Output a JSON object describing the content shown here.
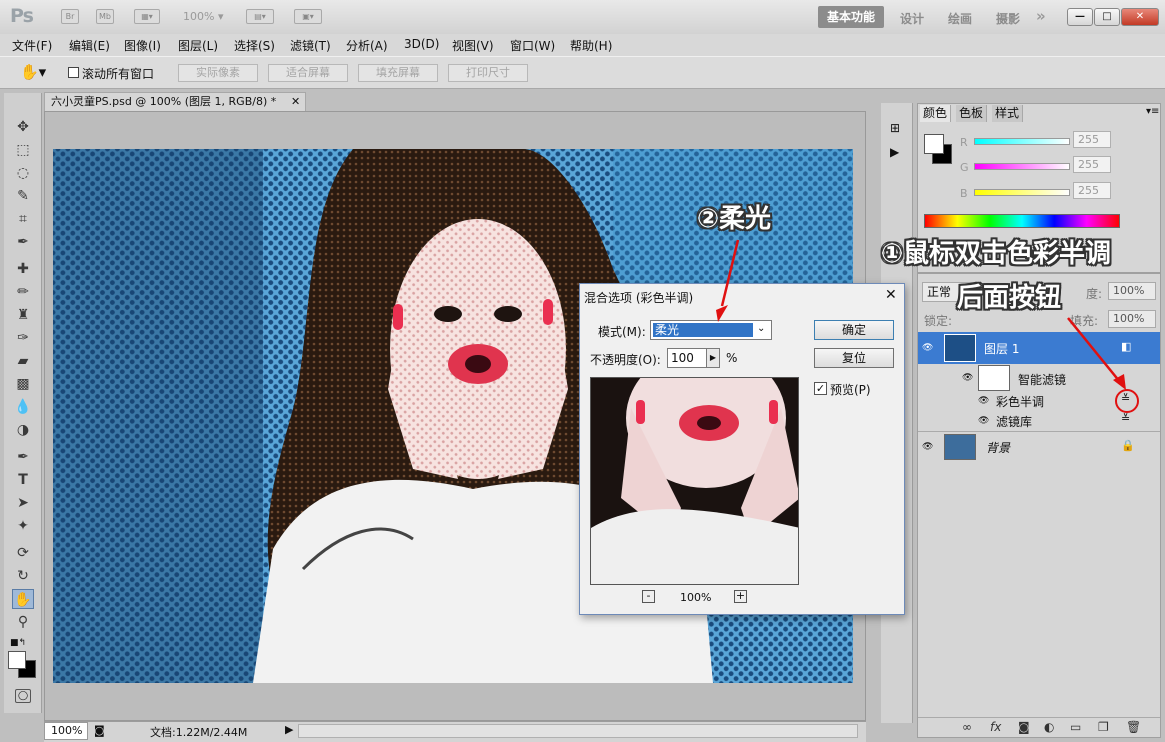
{
  "titlebar": {
    "logo": "Ps",
    "zoom": "100%",
    "icons": [
      "bridge-icon",
      "mini-bridge-icon",
      "screen-mode-icon",
      "arrange-icon",
      "extras-icon"
    ],
    "workspaces": {
      "active": "基本功能",
      "items": [
        "设计",
        "绘画",
        "摄影"
      ]
    }
  },
  "menu": [
    "文件(F)",
    "编辑(E)",
    "图像(I)",
    "图层(L)",
    "选择(S)",
    "滤镜(T)",
    "分析(A)",
    "3D(D)",
    "视图(V)",
    "窗口(W)",
    "帮助(H)"
  ],
  "options": {
    "scroll_all": "滚动所有窗口",
    "buttons": [
      "实际像素",
      "适合屏幕",
      "填充屏幕",
      "打印尺寸"
    ]
  },
  "document": {
    "tab": "六小灵童PS.psd @ 100% (图层 1, RGB/8) *",
    "zoom": "100%",
    "size": "文档:1.22M/2.44M"
  },
  "dialog": {
    "title": "混合选项 (彩色半调)",
    "mode_label": "模式(M):",
    "mode_value": "柔光",
    "opacity_label": "不透明度(O):",
    "opacity_value": "100",
    "opacity_unit": "%",
    "ok": "确定",
    "reset": "复位",
    "preview": "预览(P)",
    "zoom": "100%"
  },
  "color_panel": {
    "tabs": [
      "颜色",
      "色板",
      "样式"
    ],
    "r_label": "R",
    "g_label": "G",
    "b_label": "B",
    "r": "255",
    "g": "255",
    "b": "255"
  },
  "layers": {
    "blend_mode": "正常",
    "opacity_label": "度:",
    "opacity": "100%",
    "lock_label": "锁定:",
    "fill_label": "填充:",
    "fill": "100%",
    "items": [
      {
        "name": "图层 1"
      },
      {
        "name": "智能滤镜"
      },
      {
        "name": "彩色半调"
      },
      {
        "name": "滤镜库"
      },
      {
        "name": "背景"
      }
    ]
  },
  "annotations": {
    "step2": "②柔光",
    "step1_line1": "①鼠标双击色彩半调",
    "step1_line2": "后面按钮"
  }
}
